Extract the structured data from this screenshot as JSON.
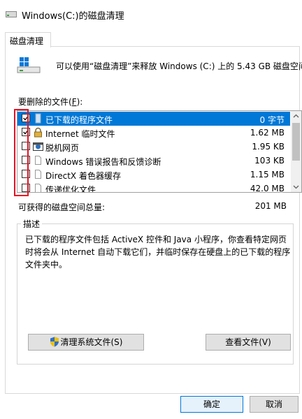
{
  "window": {
    "title": "Windows(C:)的磁盘清理"
  },
  "tab": {
    "label": "磁盘清理"
  },
  "info": {
    "text": "可以使用“磁盘清理”来释放 Windows (C:) 上的 5.43 GB 磁盘空间。"
  },
  "files": {
    "label_prefix": "要删除的文件(",
    "label_key": "F",
    "label_suffix": "):",
    "items": [
      {
        "name": "已下载的程序文件",
        "size": "0 字节",
        "checked": true,
        "selected": true,
        "icon": "folder-icon"
      },
      {
        "name": "Internet 临时文件",
        "size": "1.62 MB",
        "checked": true,
        "selected": false,
        "icon": "lock-icon"
      },
      {
        "name": "脱机网页",
        "size": "1.95 KB",
        "checked": false,
        "selected": false,
        "icon": "offline-webpage-icon"
      },
      {
        "name": "Windows 错误报告和反馈诊断",
        "size": "103 KB",
        "checked": false,
        "selected": false,
        "icon": "file-icon"
      },
      {
        "name": "DirectX 着色器缓存",
        "size": "1.15 MB",
        "checked": false,
        "selected": false,
        "icon": "file-icon"
      },
      {
        "name": "传递优化文件",
        "size": "42.0 MB",
        "checked": false,
        "selected": false,
        "icon": "file-icon"
      }
    ]
  },
  "total": {
    "label": "可获得的磁盘空间总量:",
    "value": "201 MB"
  },
  "description": {
    "title": "描述",
    "body": "已下载的程序文件包括 ActiveX 控件和 Java 小程序，你查看特定网页时将会从 Internet 自动下载它们，并临时保存在硬盘上的已下载的程序文件夹中。"
  },
  "buttons": {
    "cleanup_system": "清理系统文件(S)",
    "view_files": "查看文件(V)",
    "ok": "确定",
    "cancel": "取消"
  },
  "colors": {
    "selection": "#0078d7",
    "highlight": "#e81123"
  }
}
